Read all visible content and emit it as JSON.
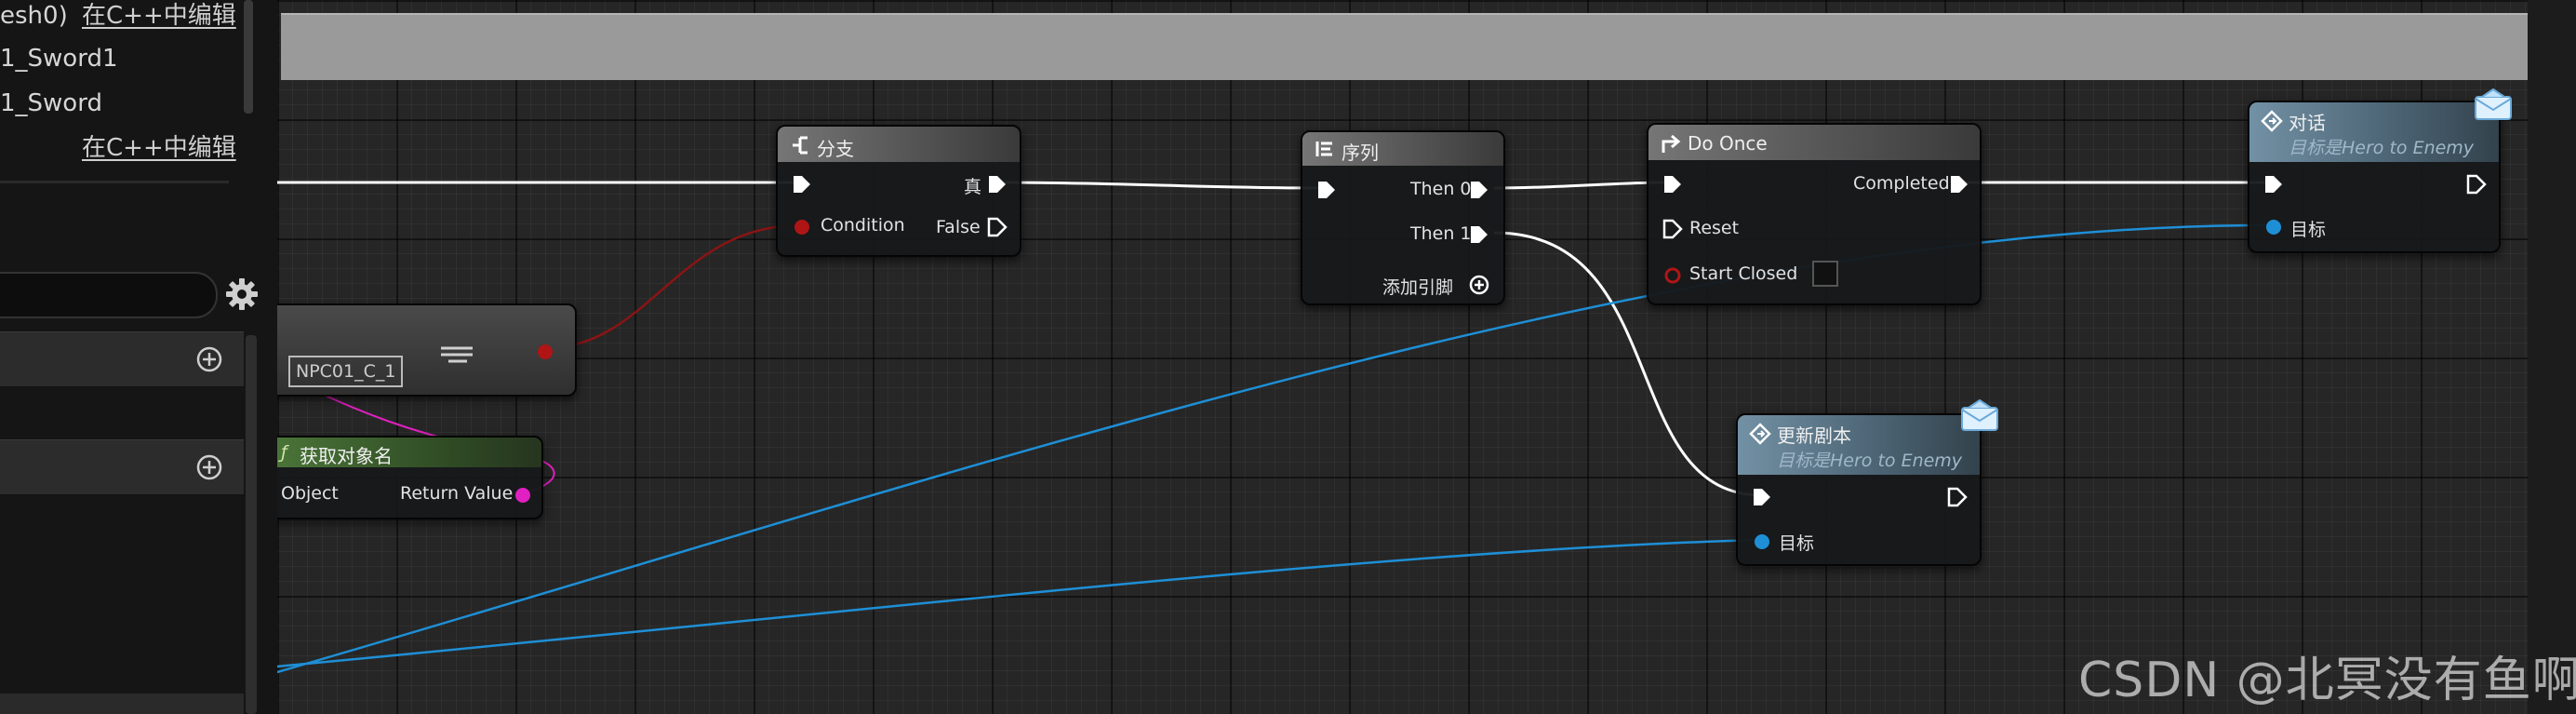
{
  "details": {
    "row1_prefix": "esh0)",
    "row1_link": "在C++中编辑",
    "row2": "1_Sword1",
    "row3": "1_Sword",
    "row4_link": "在C++中编辑"
  },
  "nodes": {
    "branch": {
      "title": "分支",
      "true_label": "真",
      "condition_label": "Condition",
      "false_label": "False"
    },
    "sequence": {
      "title": "序列",
      "then0_label": "Then 0",
      "then1_label": "Then 1",
      "add_pin_label": "添加引脚"
    },
    "do_once": {
      "title": "Do Once",
      "completed_label": "Completed",
      "reset_label": "Reset",
      "start_closed_label": "Start Closed"
    },
    "dialog": {
      "title": "对话",
      "subtitle": "目标是Hero to Enemy",
      "target_label": "目标"
    },
    "update_script": {
      "title": "更新剧本",
      "subtitle": "目标是Hero to Enemy",
      "target_label": "目标"
    },
    "get_object_name": {
      "title": "获取对象名",
      "object_label": "Object",
      "return_label": "Return Value"
    },
    "variable": {
      "value": "NPC01_C_1"
    }
  },
  "watermark": "CSDN @北冥没有鱼啊",
  "colors": {
    "exec_wire": "#ffffff",
    "bool_wire": "#8a1414",
    "object_wire": "#1e8fd6",
    "string_wire": "#e020c0",
    "function_header": "#3b5a2e",
    "event_header": "#4a6272"
  }
}
